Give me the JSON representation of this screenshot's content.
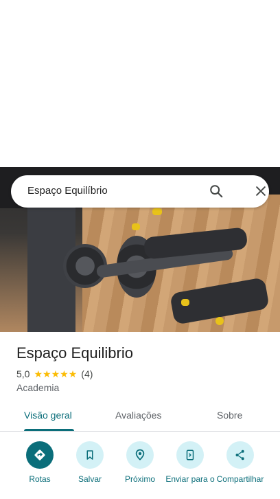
{
  "search": {
    "query": "Espaço Equilíbrio"
  },
  "place": {
    "title": "Espaço Equilibrio",
    "rating": "5,0",
    "review_count": "(4)",
    "stars": 5,
    "category": "Academia"
  },
  "tabs": [
    {
      "label": "Visão geral",
      "active": true
    },
    {
      "label": "Avaliações",
      "active": false
    },
    {
      "label": "Sobre",
      "active": false
    }
  ],
  "actions": [
    {
      "label": "Rotas",
      "icon": "directions-icon"
    },
    {
      "label": "Salvar",
      "icon": "bookmark-icon"
    },
    {
      "label": "Próximo",
      "icon": "nearby-icon"
    },
    {
      "label": "Enviar para o",
      "icon": "send-to-phone-icon"
    },
    {
      "label": "Compartilhar",
      "icon": "share-icon"
    }
  ],
  "colors": {
    "accent": "#0b6e7a",
    "action_bg": "#d3f1f6",
    "star": "#fbbc04"
  }
}
